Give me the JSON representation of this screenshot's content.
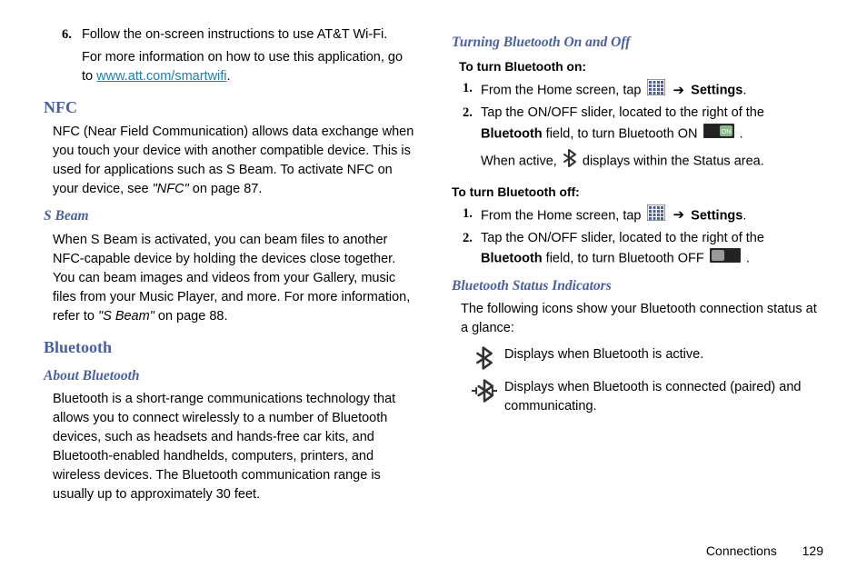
{
  "left": {
    "step6": {
      "num": "6.",
      "line1": "Follow the on-screen instructions to use AT&T Wi-Fi.",
      "line2_a": "For more information on how to use this application, go to ",
      "line2_link": "www.att.com/smartwifi",
      "line2_b": "."
    },
    "nfc": {
      "heading": "NFC",
      "body": "NFC (Near Field Communication) allows data exchange when you touch your device with another compatible device. This is used for applications such as S Beam. To activate NFC on your device, see ",
      "ref": "\"NFC\"",
      "ref_suffix": " on page 87."
    },
    "sbeam": {
      "heading": "S Beam",
      "body": "When S Beam is activated, you can beam files to another NFC-capable device by holding the devices close together. You can beam images and videos from your Gallery, music files from your Music Player, and more. For more information, refer to ",
      "ref": "\"S Beam\" ",
      "ref_suffix": " on page 88."
    },
    "bluetooth": {
      "heading": "Bluetooth",
      "about_heading": "About Bluetooth",
      "about_body": "Bluetooth is a short-range communications technology that allows you to connect wirelessly to a number of Bluetooth devices, such as headsets and hands-free car kits, and Bluetooth-enabled handhelds, computers, printers, and wireless devices. The Bluetooth communication range is usually up to approximately 30 feet."
    }
  },
  "right": {
    "turning_heading": "Turning Bluetooth On and Off",
    "on_label": "To turn Bluetooth on:",
    "on_step1_num": "1.",
    "on_step1_a": "From the Home screen, tap ",
    "on_step1_b": "Settings",
    "on_step2_num": "2.",
    "on_step2_a": "Tap the ON/OFF slider, located to the right of the ",
    "on_step2_bt": "Bluetooth",
    "on_step2_b": " field, to turn Bluetooth ON ",
    "on_step2_c": "When active, ",
    "on_step2_d": " displays within the Status area.",
    "off_label": "To turn Bluetooth off:",
    "off_step1_num": "1.",
    "off_step1_a": "From the Home screen, tap ",
    "off_step1_b": "Settings",
    "off_step2_num": "2.",
    "off_step2_a": "Tap the ON/OFF slider, located to the right of the ",
    "off_step2_bt": "Bluetooth",
    "off_step2_b": " field, to turn Bluetooth OFF ",
    "status_heading": "Bluetooth Status Indicators",
    "status_intro": "The following icons show your Bluetooth connection status at a glance:",
    "status1": "Displays when Bluetooth is active.",
    "status2": "Displays when Bluetooth is connected (paired) and communicating."
  },
  "footer": {
    "section": "Connections",
    "page": "129"
  }
}
